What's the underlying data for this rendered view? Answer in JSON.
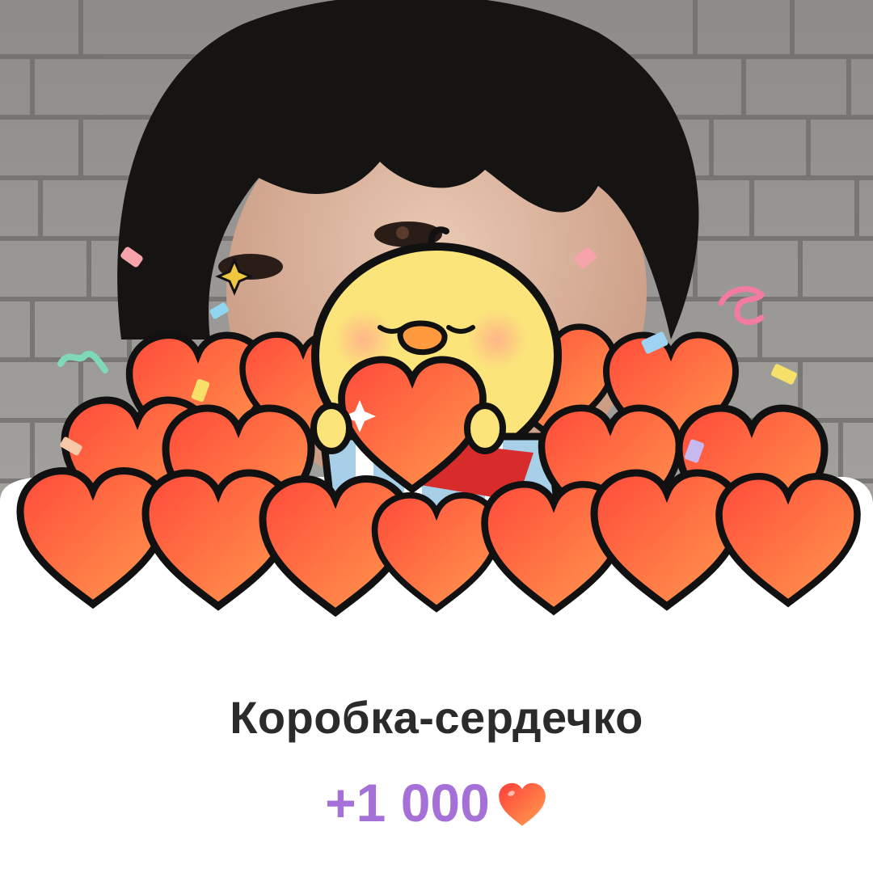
{
  "gift": {
    "title": "Коробка-сердечко",
    "reward": "+1 000",
    "reward_icon": "heart-icon"
  },
  "colors": {
    "title": "#2b2b2b",
    "reward": "#a571d8",
    "heart": "#ff5a3c",
    "chick": "#fbe57a",
    "background": "#ffffff"
  }
}
